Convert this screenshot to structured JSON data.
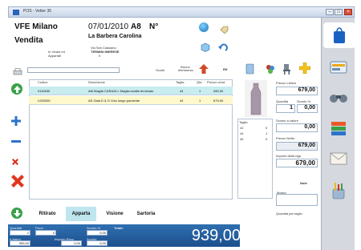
{
  "window": {
    "title": "POS - Vetter 36"
  },
  "header": {
    "store": "VFE Milano",
    "date": "07/01/2010",
    "register": "A8",
    "doc_no_label": "N°",
    "mode": "Vendita",
    "customer": "La Barbera Carolina",
    "address_line1": "Via San Cassiano",
    "address_line2": "TERMINI IMERESE",
    "address_line3": "0",
    "status_line1": "In Vivaio ed",
    "status_line2": "Appartati",
    "toolbar_label1": "Sconti",
    "toolbar_label2": "Buono\nriferimento",
    "toolbar_label3": "Rif"
  },
  "table": {
    "columns": [
      "Codice",
      "Descrizione",
      "Taglia",
      "Qta",
      "Prezzo vend."
    ],
    "rows": [
      {
        "code": "0116530",
        "desc": "AM Maglia CARAGLI: Maglia scialle termicato",
        "size": "44",
        "qty": "1",
        "price": "280,00"
      },
      {
        "code": "L000300",
        "desc": "AS Gala D & G Volo lungo parziente",
        "size": "44",
        "qty": "1",
        "price": "679,00"
      }
    ]
  },
  "sizes_panel": {
    "title": "Taglia",
    "rows": [
      {
        "size": "42",
        "qty": "0"
      },
      {
        "size": "44",
        "qty": "1"
      },
      {
        "size": "46",
        "qty": "0"
      }
    ]
  },
  "right_panel": {
    "list_price_label": "Prezzo Listino",
    "list_price": "679,00",
    "qty_label": "Quantità",
    "qty": "1",
    "discount_label": "Sconto %",
    "discount": "0,00",
    "amount_discount_label": "Sconto a valore",
    "amount_discount": "0,00",
    "net_price_label": "Prezzo Netto",
    "net_price": "679,00",
    "line_total_label": "Importo della riga",
    "line_total": "679,00",
    "note_label": "Note",
    "reason_label": "Motivo",
    "qty_per_size_label": "Quantità per taglio"
  },
  "tabs": [
    "Ritirato",
    "Apparta",
    "Visione",
    "Sartoria"
  ],
  "footer": {
    "qty_label": "Quantità",
    "qty": "2",
    "pieces_label": "Pezzi",
    "pieces": "0",
    "discount_label": "Sconto %",
    "discount": "0,00",
    "total_label": "Totale",
    "listino_label": "A listino",
    "listino": "959,00",
    "reso_label": "Importo Reso",
    "reso": "0,00",
    "saldo_label": "Sconto",
    "saldo": "0,00",
    "grand_total": "939,00"
  },
  "colors": {
    "accent": "#1d4f8d",
    "selected_row": "#c8ecef",
    "highlight_row": "#fff8cc"
  }
}
